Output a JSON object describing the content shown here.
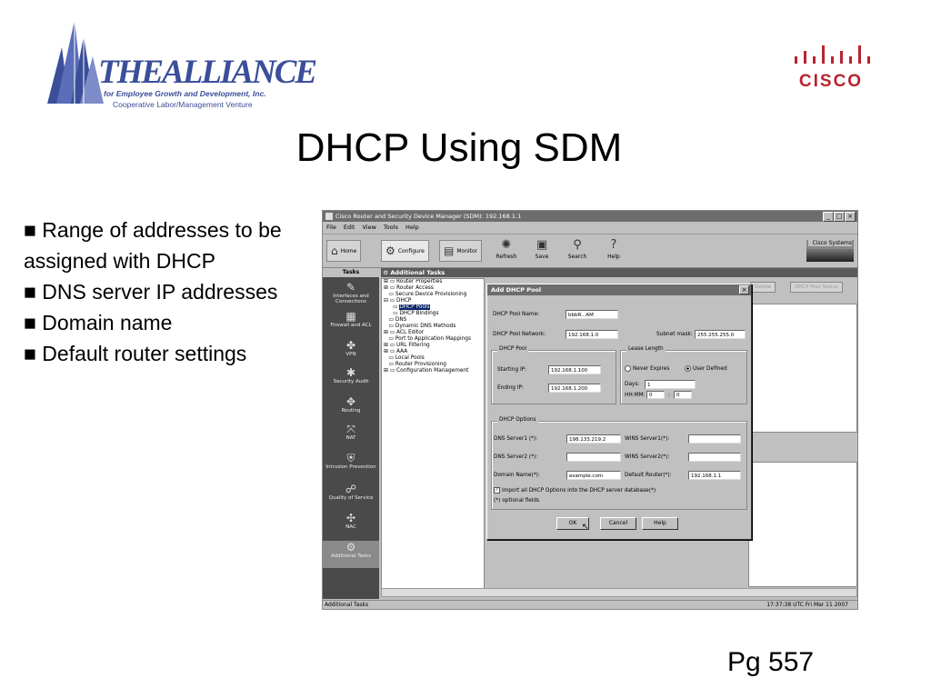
{
  "slide": {
    "title": "DHCP Using SDM",
    "bullets": [
      "Range of addresses to be assigned with DHCP",
      "DNS server IP addresses",
      "Domain name",
      "Default router settings"
    ],
    "bullet_marker": "■",
    "page": "Pg 557",
    "logo_left": {
      "name": "THEALLIANCE",
      "tagline1": "for Employee Growth and Development, Inc.",
      "tagline2": "Cooperative Labor/Management Venture",
      "color": "#3b4e9a"
    },
    "logo_right": {
      "name": "CISCO",
      "color": "#b8232f"
    }
  },
  "window": {
    "title": "Cisco Router and Security Device Manager (SDM): 192.168.1.1",
    "controls": [
      "_",
      "□",
      "×"
    ],
    "menu": [
      "File",
      "Edit",
      "View",
      "Tools",
      "Help"
    ],
    "toolbar": {
      "home": "Home",
      "configure": "Configure",
      "monitor": "Monitor",
      "refresh": "Refresh",
      "save": "Save",
      "search": "Search",
      "help": "Help",
      "brand": "Cisco Systems"
    },
    "tasks_header": "Tasks",
    "tasks": [
      "Interfaces and Connections",
      "Firewall and ACL",
      "VPN",
      "Security Audit",
      "Routing",
      "NAT",
      "Intrusion Prevention",
      "Quality of Service",
      "NAC",
      "Additional Tasks"
    ],
    "additional_tasks_header": "Additional Tasks",
    "tree": [
      "Router Properties",
      "Router Access",
      "Secure Device Provisioning",
      "DHCP",
      "DHCP Pools",
      "DHCP Bindings",
      "DNS",
      "Dynamic DNS Methods",
      "ACL Editor",
      "Port to Application Mappings",
      "URL Filtering",
      "AAA",
      "Local Pools",
      "Router Provisioning",
      "Configuration Management"
    ],
    "right_buttons": [
      "Delete",
      "DHCP Pool Status"
    ],
    "status_left": "Additional Tasks",
    "status_right": "17:37:38 UTC Fri Mar 11 2007"
  },
  "dialog": {
    "title": "Add DHCP Pool",
    "pool_name_label": "DHCP Pool Name:",
    "pool_name": "bbbR...AM",
    "pool_network_label": "DHCP Pool Network:",
    "pool_network": "192.168.1.0",
    "subnet_mask_label": "Subnet mask:",
    "subnet_mask": "255.255.255.0",
    "pool_group": "DHCP Pool",
    "starting_ip_label": "Starting IP:",
    "starting_ip": "192.168.1.100",
    "ending_ip_label": "Ending IP:",
    "ending_ip": "192.168.1.200",
    "lease_group": "Lease Length",
    "never_expires": "Never Expires",
    "user_defined": "User Defined",
    "days_label": "Days:",
    "days": "1",
    "hhmm_label": "HH:MM:",
    "hh": "0",
    "mm": "0",
    "options_group": "DHCP Options",
    "dns1_label": "DNS Server1 (*):",
    "dns1": "198.133.219.2",
    "wins1_label": "WINS Server1(*):",
    "wins1": "",
    "dns2_label": "DNS Server2 (*):",
    "dns2": "",
    "wins2_label": "WINS Server2(*):",
    "wins2": "",
    "domain_label": "Domain Name(*):",
    "domain": "example.com",
    "router_label": "Default Router(*):",
    "router": "192.168.1.1",
    "import_label": "Import all DHCP Options into the DHCP server database(*)",
    "optional_note": "(*) optional fields",
    "ok": "OK",
    "cancel": "Cancel",
    "help": "Help"
  }
}
